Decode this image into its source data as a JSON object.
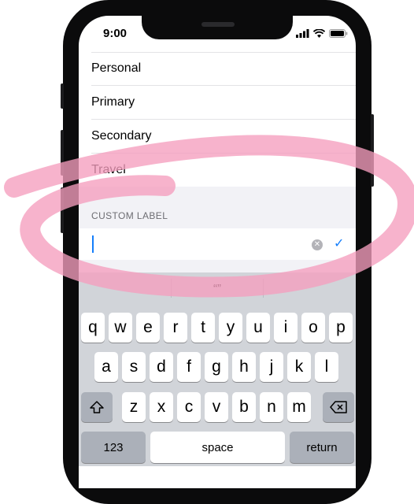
{
  "status_bar": {
    "time": "9:00"
  },
  "list": {
    "items": [
      "Personal",
      "Primary",
      "Secondary",
      "Travel"
    ]
  },
  "custom_label": {
    "section_title": "CUSTOM LABEL",
    "input_value": "",
    "clear_glyph": "✕",
    "confirm_glyph": "✓"
  },
  "keyboard": {
    "predictions": [
      "",
      "“”",
      ""
    ],
    "row1": [
      "q",
      "w",
      "e",
      "r",
      "t",
      "y",
      "u",
      "i",
      "o",
      "p"
    ],
    "row2": [
      "a",
      "s",
      "d",
      "f",
      "g",
      "h",
      "j",
      "k",
      "l"
    ],
    "row3": [
      "z",
      "x",
      "c",
      "v",
      "b",
      "n",
      "m"
    ],
    "numbers_key": "123",
    "space_key": "space",
    "return_key": "return",
    "shift_icon": "shift-arrow-icon",
    "delete_icon": "backspace-icon"
  },
  "annotation": {
    "color": "#f59dbe"
  }
}
